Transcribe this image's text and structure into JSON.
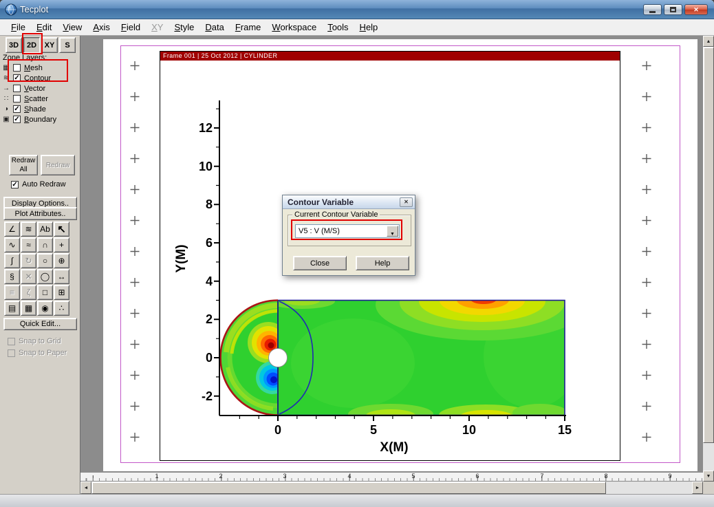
{
  "window": {
    "title": "Tecplot"
  },
  "icons": {
    "close": "✕",
    "dropdown_arrow": "▼",
    "scroll_up": "▲",
    "scroll_down": "▼",
    "scroll_left": "◄",
    "scroll_right": "►"
  },
  "colors": {
    "annotation_red": "#e10000",
    "frame_header_bg": "#a00000",
    "titlebar_blue": "#5d8cbe",
    "contour_base_green": "#2fd02f",
    "paper_margin_magenta": "#c257c8"
  },
  "menubar": {
    "items": [
      {
        "label": "File",
        "enabled": true
      },
      {
        "label": "Edit",
        "enabled": true
      },
      {
        "label": "View",
        "enabled": true
      },
      {
        "label": "Axis",
        "enabled": true
      },
      {
        "label": "Field",
        "enabled": true
      },
      {
        "label": "XY",
        "enabled": false
      },
      {
        "label": "Style",
        "enabled": true
      },
      {
        "label": "Data",
        "enabled": true
      },
      {
        "label": "Frame",
        "enabled": true
      },
      {
        "label": "Workspace",
        "enabled": true
      },
      {
        "label": "Tools",
        "enabled": true
      },
      {
        "label": "Help",
        "enabled": true
      }
    ]
  },
  "modebar": {
    "buttons": [
      "3D",
      "2D",
      "XY",
      "S"
    ]
  },
  "sidebar": {
    "zone_layers_label": "Zone Layers:",
    "layers": [
      {
        "label": "Mesh",
        "icon_glyph": "▦",
        "checked": false
      },
      {
        "label": "Contour",
        "icon_glyph": "≋",
        "checked": true
      },
      {
        "label": "Vector",
        "icon_glyph": "→",
        "checked": false
      },
      {
        "label": "Scatter",
        "icon_glyph": "∷",
        "checked": false
      },
      {
        "label": "Shade",
        "icon_glyph": "◑",
        "checked": true
      },
      {
        "label": "Boundary",
        "icon_glyph": "▣",
        "checked": true
      }
    ],
    "redraw_all_label": "Redraw All",
    "redraw_label": "Redraw",
    "auto_redraw_label": "Auto Redraw",
    "auto_redraw_checked": true,
    "display_options_label": "Display Options..",
    "plot_attributes_label": "Plot Attributes..",
    "quick_edit_label": "Quick Edit...",
    "snap_to_grid_label": "Snap to Grid",
    "snap_to_paper_label": "Snap to Paper"
  },
  "tools": {
    "items": [
      {
        "glyph": "∠",
        "enabled": true
      },
      {
        "glyph": "≋",
        "enabled": true
      },
      {
        "glyph": "Ab",
        "enabled": true
      },
      {
        "glyph": "↖",
        "enabled": true
      },
      {
        "glyph": "∿",
        "enabled": true
      },
      {
        "glyph": "≈",
        "enabled": true
      },
      {
        "glyph": "∩",
        "enabled": true
      },
      {
        "glyph": "+",
        "enabled": true
      },
      {
        "glyph": "∫",
        "enabled": true
      },
      {
        "glyph": "↻",
        "enabled": false
      },
      {
        "glyph": "○",
        "enabled": true
      },
      {
        "glyph": "⊕",
        "enabled": true
      },
      {
        "glyph": "§",
        "enabled": true
      },
      {
        "glyph": "✕",
        "enabled": false
      },
      {
        "glyph": "◯",
        "enabled": true
      },
      {
        "glyph": "↔",
        "enabled": true
      },
      {
        "glyph": "≡",
        "enabled": false
      },
      {
        "glyph": "ζ",
        "enabled": false
      },
      {
        "glyph": "□",
        "enabled": true
      },
      {
        "glyph": "⊞",
        "enabled": true
      },
      {
        "glyph": "▤",
        "enabled": true
      },
      {
        "glyph": "▦",
        "enabled": true
      },
      {
        "glyph": "◉",
        "enabled": true
      },
      {
        "glyph": "∴",
        "enabled": true
      }
    ]
  },
  "frame": {
    "header": "Frame 001 | 25 Oct 2012 | CYLINDER"
  },
  "plot": {
    "y_label": "Y(M)",
    "x_label": "X(M)",
    "y_ticks": [
      "12",
      "10",
      "8",
      "6",
      "4",
      "2",
      "0",
      "-2"
    ],
    "x_ticks": [
      "0",
      "5",
      "10",
      "15"
    ]
  },
  "dialog": {
    "title": "Contour Variable",
    "group_label": "Current Contour Variable",
    "variable_value": "V5 : V (M/S)",
    "close_label": "Close",
    "help_label": "Help"
  },
  "ruler": {
    "numbers": [
      "1",
      "2",
      "3",
      "4",
      "5",
      "6",
      "7",
      "8",
      "9"
    ]
  }
}
